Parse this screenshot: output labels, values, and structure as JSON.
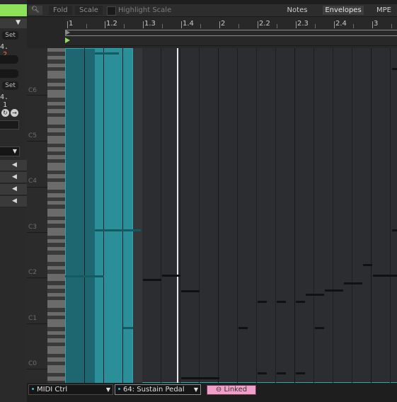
{
  "toolbar": {
    "fold": "Fold",
    "scale": "Scale",
    "highlight_scale": "Highlight Scale",
    "tab_notes": "Notes",
    "tab_envelopes": "Envelopes",
    "tab_mpe": "MPE"
  },
  "left_panel": {
    "set_1": "Set",
    "set_2": "Set",
    "value_1_a": "4.",
    "value_1_b": "2",
    "value_2_a": "4.",
    "value_2_b": "1"
  },
  "ruler": {
    "labels": [
      "1",
      "1.2",
      "1.3",
      "1.4",
      "2",
      "2.2",
      "2.3",
      "2.4",
      "3"
    ]
  },
  "octave_labels": [
    "C6",
    "C5",
    "C4",
    "C3",
    "C2",
    "C1",
    "C0"
  ],
  "bottom": {
    "device": "MIDI Ctrl",
    "controller": "64: Sustain Pedal",
    "linked": "Linked"
  },
  "colors": {
    "accent_green": "#8ee25a",
    "selection_teal": "#2aa9b3",
    "linked_pink": "#f0a0c8",
    "value_orange": "#ff6a3a"
  },
  "icons": [
    "search-icon",
    "chevron-down-icon",
    "triangle-left-icon",
    "loop-icon",
    "arrow-right-icon",
    "link-icon"
  ]
}
